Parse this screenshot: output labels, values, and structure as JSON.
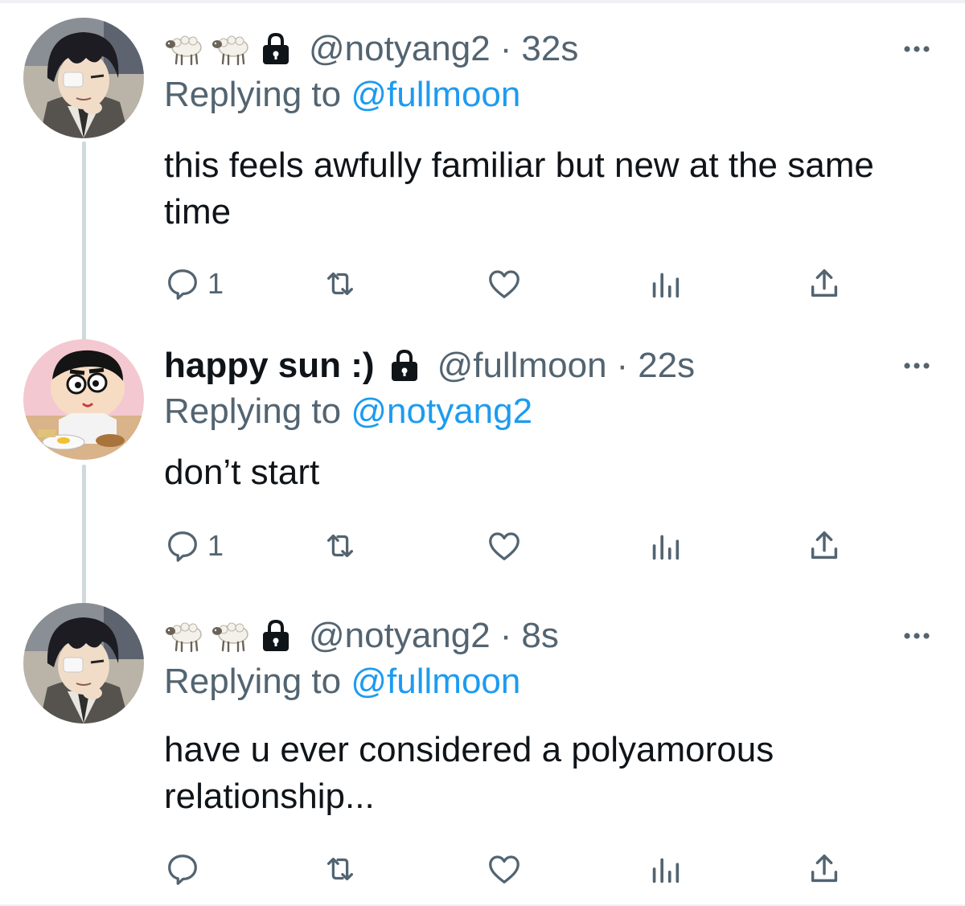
{
  "tweets": [
    {
      "display_name": "",
      "has_sheep_emoji": true,
      "handle": "@notyang2",
      "separator": "·",
      "time": "32s",
      "replying_prefix": "Replying to",
      "replying_to": "@fullmoon",
      "text": "this feels awfully familiar but new at the same time",
      "reply_count": "1",
      "avatar": "anime-boy-eyepatch"
    },
    {
      "display_name": "happy sun :)",
      "has_sheep_emoji": false,
      "handle": "@fullmoon",
      "separator": "·",
      "time": "22s",
      "replying_prefix": "Replying to",
      "replying_to": "@notyang2",
      "text": "don’t start",
      "reply_count": "1",
      "avatar": "cartoon-kid-lunch"
    },
    {
      "display_name": "",
      "has_sheep_emoji": true,
      "handle": "@notyang2",
      "separator": "·",
      "time": "8s",
      "replying_prefix": "Replying to",
      "replying_to": "@fullmoon",
      "text": "have u ever considered a polyamorous relationship...",
      "reply_count": "",
      "avatar": "anime-boy-eyepatch"
    }
  ],
  "icons": {
    "reply": "reply-icon",
    "retweet": "retweet-icon",
    "like": "heart-icon",
    "analytics": "analytics-icon",
    "share": "share-icon",
    "more": "more-icon",
    "lock": "lock-icon",
    "sheep": "sheep-emoji-icon"
  },
  "colors": {
    "text": "#0f1419",
    "secondary": "#536471",
    "link": "#1d9bf0",
    "thread_line": "#cfd9de"
  }
}
